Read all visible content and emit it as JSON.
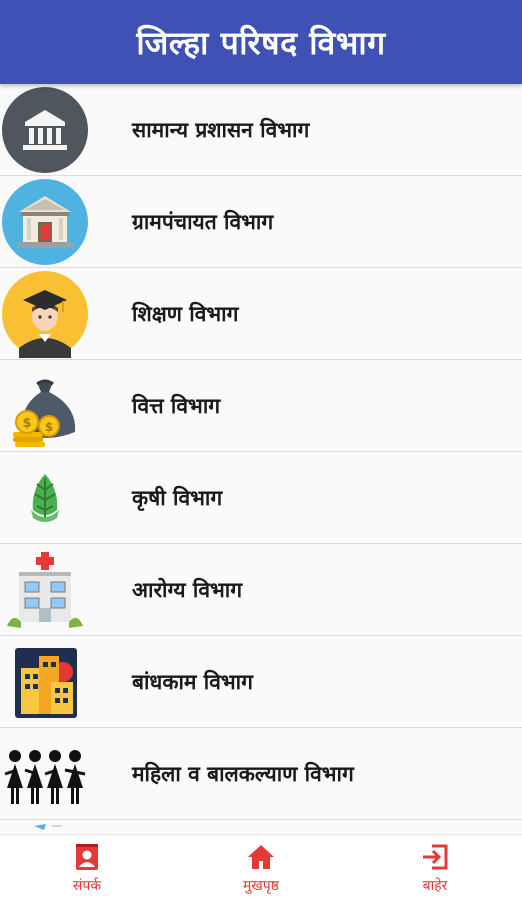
{
  "header": {
    "title": "जिल्हा परिषद विभाग"
  },
  "departments": [
    {
      "label": "सामान्य प्रशासन विभाग",
      "icon": "bank-building-icon"
    },
    {
      "label": "ग्रामपंचायत विभाग",
      "icon": "village-building-icon"
    },
    {
      "label": "शिक्षण विभाग",
      "icon": "graduate-student-icon"
    },
    {
      "label": "वित्त विभाग",
      "icon": "money-bag-icon"
    },
    {
      "label": "कृषी विभाग",
      "icon": "plant-leaf-icon"
    },
    {
      "label": "आरोग्य विभाग",
      "icon": "hospital-icon"
    },
    {
      "label": "बांधकाम विभाग",
      "icon": "city-buildings-icon"
    },
    {
      "label": "महिला व बालकल्याण विभाग",
      "icon": "women-group-icon"
    }
  ],
  "bottom_nav": {
    "contact": {
      "label": "संपर्क",
      "icon": "contact-card-icon"
    },
    "home": {
      "label": "मुखपृष्ठ",
      "icon": "home-icon"
    },
    "exit": {
      "label": "बाहेर",
      "icon": "exit-icon"
    }
  },
  "colors": {
    "app_bar": "#3f51b5",
    "nav_accent": "#e53935"
  }
}
